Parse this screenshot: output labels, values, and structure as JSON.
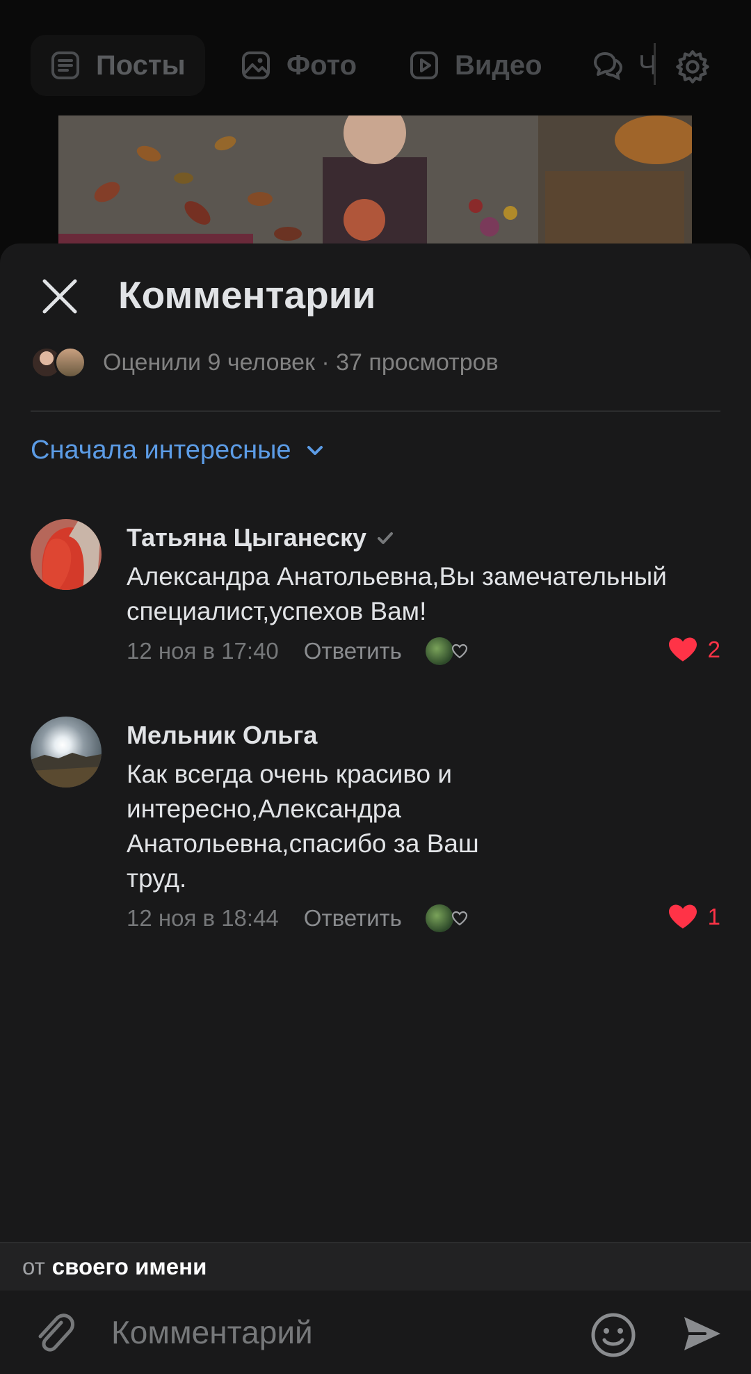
{
  "background": {
    "tabs": [
      {
        "label": "Посты",
        "icon": "posts-icon"
      },
      {
        "label": "Фото",
        "icon": "photo-icon"
      },
      {
        "label": "Видео",
        "icon": "video-icon"
      },
      {
        "label": "Ч",
        "icon": "chat-icon"
      }
    ],
    "settings_icon": "gear-icon"
  },
  "sheet": {
    "title": "Комментарии",
    "close_icon": "close-icon",
    "likers_text": "Оценили 9 человек · 37 просмотров",
    "sort_label": "Сначала интересные"
  },
  "comments": [
    {
      "author": "Татьяна Цыганеску",
      "text": "Александра Анатольевна,Вы замечательный специалист,успехов Вам!",
      "time": "12 ноя в 17:40",
      "reply": "Ответить",
      "likes": "2"
    },
    {
      "author": "Мельник Ольга",
      "text": "Как всегда очень красиво и интересно,Александра Анатольевна,спасибо за Ваш труд.",
      "time": "12 ноя в 18:44",
      "reply": "Ответить",
      "likes": "1"
    }
  ],
  "composer": {
    "from_prefix": "от",
    "from_name": "своего имени",
    "placeholder": "Комментарий"
  },
  "colors": {
    "accent": "#5c9ce6",
    "like": "#ff3347",
    "sheet_bg": "#19191a"
  }
}
